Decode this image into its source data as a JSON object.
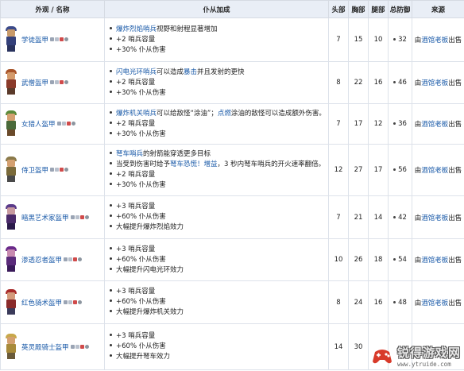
{
  "headers": {
    "appearance_name": "外观 / 名称",
    "bonus": "仆从加成",
    "head": "头部",
    "body": "胸部",
    "legs": "腿部",
    "total": "总防御",
    "source": "来源"
  },
  "rows": [
    {
      "name": "学徒盔甲",
      "colors": {
        "hat": "#3b4a8a",
        "head": "#c89a6a",
        "body": "#34407a",
        "legs": "#2a335e"
      },
      "bonus": [
        [
          {
            "t": "爆炸烈焰哨兵",
            "hl": true
          },
          {
            "t": "视野和射程显著增加"
          }
        ],
        [
          {
            "t": "+2 哨兵容量"
          }
        ],
        [
          {
            "t": "+30% 仆从伤害"
          }
        ]
      ],
      "head": "7",
      "body": "15",
      "legs": "10",
      "total": "32",
      "source_pre": "由",
      "source_link": "酒馆老板",
      "source_post": "出售"
    },
    {
      "name": "武僧盔甲",
      "colors": {
        "hat": "#a8542a",
        "head": "#d49a6a",
        "body": "#8a3a2a",
        "legs": "#5a3a2a"
      },
      "bonus": [
        [
          {
            "t": "闪电光环哨兵",
            "hl": true
          },
          {
            "t": "可以造成"
          },
          {
            "t": "暴击",
            "hl": true
          },
          {
            "t": "并且发射的更快"
          }
        ],
        [
          {
            "t": "+2 哨兵容量"
          }
        ],
        [
          {
            "t": "+30% 仆从伤害"
          }
        ]
      ],
      "head": "8",
      "body": "22",
      "legs": "16",
      "total": "46",
      "source_pre": "由",
      "source_link": "酒馆老板",
      "source_post": "出售"
    },
    {
      "name": "女猎人盔甲",
      "colors": {
        "hat": "#5a8a3a",
        "head": "#d4a070",
        "body": "#4a6a3a",
        "legs": "#6a4a2a"
      },
      "bonus": [
        [
          {
            "t": "爆炸机关哨兵",
            "hl": true
          },
          {
            "t": "可以给敌怪“涂油”；"
          },
          {
            "t": "点燃",
            "hl": true
          },
          {
            "t": "涂油的敌怪可以造成额外伤害。"
          }
        ],
        [
          {
            "t": "+2 哨兵容量"
          }
        ],
        [
          {
            "t": "+30% 仆从伤害"
          }
        ]
      ],
      "head": "7",
      "body": "17",
      "legs": "12",
      "total": "36",
      "source_pre": "由",
      "source_link": "酒馆老板",
      "source_post": "出售"
    },
    {
      "name": "侍卫盔甲",
      "colors": {
        "hat": "#8a7a4a",
        "head": "#d4a070",
        "body": "#7a6a3a",
        "legs": "#4a4a4a"
      },
      "bonus": [
        [
          {
            "t": "弩车哨兵",
            "hl": true
          },
          {
            "t": "的射箭能穿透更多目标"
          }
        ],
        [
          {
            "t": "当受到伤害时给予"
          },
          {
            "t": "弩车恐慌！增益",
            "hl": true
          },
          {
            "t": "，3 秒内弩车哨兵的开火速率翻倍。"
          }
        ],
        [
          {
            "t": "+2 哨兵容量"
          }
        ],
        [
          {
            "t": "+30% 仆从伤害"
          }
        ]
      ],
      "head": "12",
      "body": "27",
      "legs": "17",
      "total": "56",
      "source_pre": "由",
      "source_link": "酒馆老板",
      "source_post": "出售"
    },
    {
      "name": "暗黑艺术家盔甲",
      "colors": {
        "hat": "#5a3a8a",
        "head": "#c89aa0",
        "body": "#4a2a6a",
        "legs": "#2a1a4a"
      },
      "bonus": [
        [
          {
            "t": "+3 哨兵容量"
          }
        ],
        [
          {
            "t": "+60% 仆从伤害"
          }
        ],
        [
          {
            "t": "大幅提升爆炸烈焰效力"
          }
        ]
      ],
      "head": "7",
      "body": "21",
      "legs": "14",
      "total": "42",
      "source_pre": "由",
      "source_link": "酒馆老板",
      "source_post": "出售"
    },
    {
      "name": "渗透忍者盔甲",
      "colors": {
        "hat": "#6a2a8a",
        "head": "#c88ab0",
        "body": "#5a2a7a",
        "legs": "#3a1a5a"
      },
      "bonus": [
        [
          {
            "t": "+3 哨兵容量"
          }
        ],
        [
          {
            "t": "+60% 仆从伤害"
          }
        ],
        [
          {
            "t": "大幅提升闪电光环效力"
          }
        ]
      ],
      "head": "10",
      "body": "26",
      "legs": "18",
      "total": "54",
      "source_pre": "由",
      "source_link": "酒馆老板",
      "source_post": "出售"
    },
    {
      "name": "红色骑术盔甲",
      "colors": {
        "hat": "#a82a2a",
        "head": "#d49a7a",
        "body": "#8a2a2a",
        "legs": "#3a3a5a"
      },
      "bonus": [
        [
          {
            "t": "+3 哨兵容量"
          }
        ],
        [
          {
            "t": "+60% 仆从伤害"
          }
        ],
        [
          {
            "t": "大幅提升爆炸机关效力"
          }
        ]
      ],
      "head": "8",
      "body": "24",
      "legs": "16",
      "total": "48",
      "source_pre": "由",
      "source_link": "酒馆老板",
      "source_post": "出售"
    },
    {
      "name": "英灵殿骑士盔甲",
      "colors": {
        "hat": "#c8a84a",
        "head": "#d4a070",
        "body": "#a88a3a",
        "legs": "#6a5a3a"
      },
      "bonus": [
        [
          {
            "t": "+3 哨兵容量"
          }
        ],
        [
          {
            "t": "+60% 仆从伤害"
          }
        ],
        [
          {
            "t": "大幅提升弩车效力"
          }
        ]
      ],
      "head": "14",
      "body": "30",
      "legs": "",
      "total": "",
      "source_pre": "",
      "source_link": "",
      "source_post": ""
    }
  ],
  "watermark": {
    "title": "锐得游戏网",
    "url": "www.ytruide.com"
  }
}
